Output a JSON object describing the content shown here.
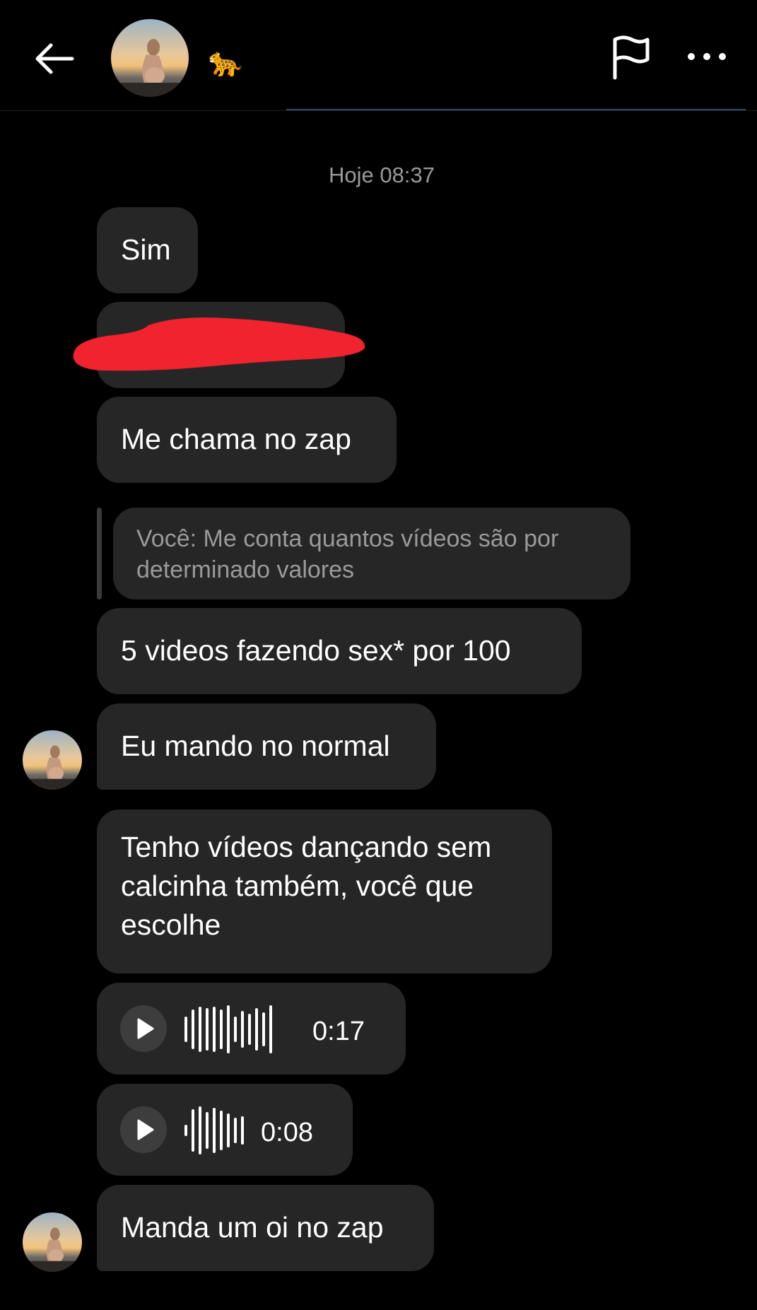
{
  "header": {
    "emoji": "🐆",
    "icons": {
      "back": "back-arrow-icon",
      "report": "flag-icon",
      "more": "more-icon"
    }
  },
  "conversation": {
    "timestamp": "Hoje 08:37",
    "messages": [
      {
        "type": "text",
        "text": "Sim"
      },
      {
        "type": "redacted",
        "text": ""
      },
      {
        "type": "text",
        "text": "Me chama no zap"
      },
      {
        "type": "reply_quote",
        "text": "Você: Me conta quantos vídeos são por\ndeterminado valores"
      },
      {
        "type": "text",
        "text": "5 videos fazendo sex* por 100"
      },
      {
        "type": "text",
        "text": "Eu mando no normal"
      },
      {
        "type": "text",
        "text": "Tenho vídeos dançando sem\ncalcinha também, você que\nescolhe"
      },
      {
        "type": "audio",
        "duration": "0:17"
      },
      {
        "type": "audio",
        "duration": "0:08"
      },
      {
        "type": "text",
        "text": "Manda um oi no zap"
      }
    ]
  },
  "colors": {
    "background": "#000000",
    "bubble": "#262626",
    "muted_text": "#9a9a9a",
    "redaction": "#f0232e",
    "header_accent": "#2f4d63"
  }
}
